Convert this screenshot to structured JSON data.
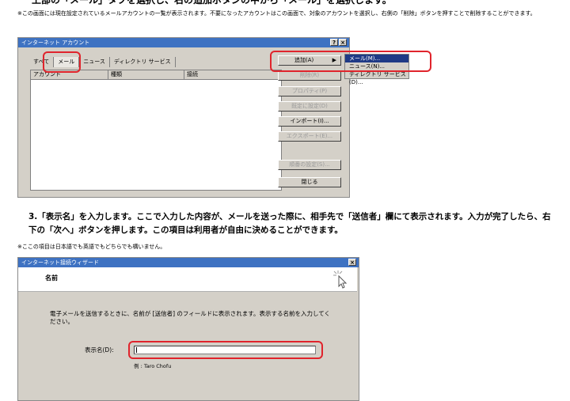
{
  "top_heading": "上部の「メール」タブを選択し、右の追加ボタンの中から「メール」を選択します。",
  "note1": "※この画面には現在設定されているメールアカウントの一覧が表示されます。不要になったアカウントはこの画面で、対象のアカウントを選択し、右側の「削除」ボタンを押すことで削除することができます。",
  "window1": {
    "title": "インターネット アカウント",
    "title_buttons": [
      "?",
      "×"
    ],
    "tabs": [
      "すべて",
      "メール",
      "ニュース",
      "ディレクトリ サービス"
    ],
    "active_tab": "メール",
    "columns": [
      "アカウント",
      "種類",
      "接続"
    ],
    "buttons": {
      "add": "追加(A)",
      "remove": "削除(R)",
      "properties": "プロパティ(P)",
      "set_default": "既定に設定(D)",
      "import": "インポート(I)...",
      "export": "エクスポート(E)...",
      "set_order": "順番の設定(S)...",
      "close": "閉じる"
    },
    "add_menu": [
      "メール(M)...",
      "ニュース(N)...",
      "ディレクトリ サービス(D)..."
    ],
    "add_menu_selected": "メール(M)..."
  },
  "step3": "3.「表示名」を入力します。ここで入力した内容が、メールを送った際に、相手先で「送信者」欄にて表示されます。入力が完了したら、右下の「次へ」ボタンを押します。この項目は利用者が自由に決めることができます。",
  "note2": "※ここの項目は日本語でも英語でもどちらでも構いません。",
  "window2": {
    "title": "インターネット接続ウィザード",
    "close_button": "×",
    "header": "名前",
    "description": "電子メールを送信するときに、名前が [送信者] のフィールドに表示されます。表示する名前を入力してください。",
    "field_label": "表示名(D):",
    "field_value": "",
    "example": "例 : Taro Chofu"
  },
  "colors": {
    "titlebar": "#3e72c2",
    "highlight": "#e0242c",
    "menu_selected": "#1f3a86",
    "dialog_bg": "#d4d0c8"
  }
}
